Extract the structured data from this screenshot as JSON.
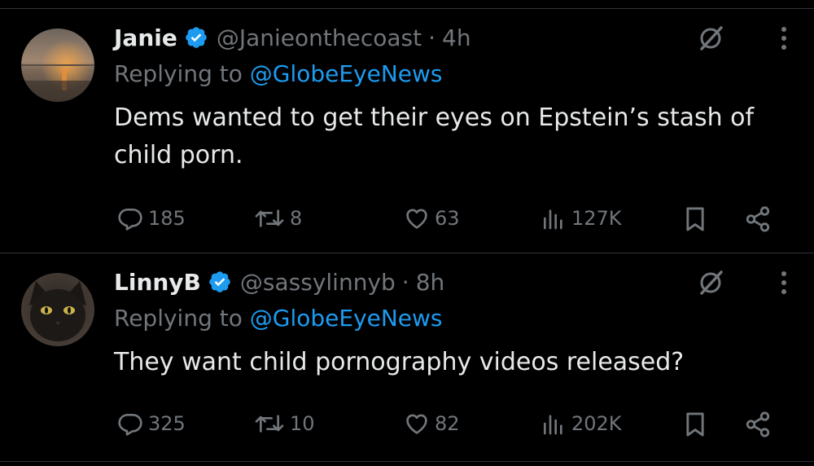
{
  "colors": {
    "background": "#000000",
    "primary_text": "#e7e9ea",
    "secondary_text": "#71767b",
    "accent": "#1d9bf0",
    "divider": "#2f3336"
  },
  "tweets": [
    {
      "name": "Janie",
      "handle": "@Janieonthecoast",
      "separator": "·",
      "time": "4h",
      "verified": true,
      "replying_prefix": "Replying to",
      "replying_to": "@GlobeEyeNews",
      "text": "Dems wanted to get their eyes on Epstein’s stash of child porn.",
      "avatar_icon": "sunset-beach-avatar",
      "stats": {
        "replies": "185",
        "reposts": "8",
        "likes": "63",
        "views": "127K"
      }
    },
    {
      "name": "LinnyB",
      "handle": "@sassylinnyb",
      "separator": "·",
      "time": "8h",
      "verified": true,
      "replying_prefix": "Replying to",
      "replying_to": "@GlobeEyeNews",
      "text": "They want child pornography videos released?",
      "avatar_icon": "black-cat-avatar",
      "stats": {
        "replies": "325",
        "reposts": "10",
        "likes": "82",
        "views": "202K"
      }
    }
  ],
  "icons": {
    "verified": "verified-badge-icon",
    "grok": "grok-icon",
    "more": "more-icon",
    "reply": "reply-icon",
    "repost": "repost-icon",
    "like": "heart-icon",
    "views": "views-icon",
    "bookmark": "bookmark-icon",
    "share": "share-icon"
  }
}
